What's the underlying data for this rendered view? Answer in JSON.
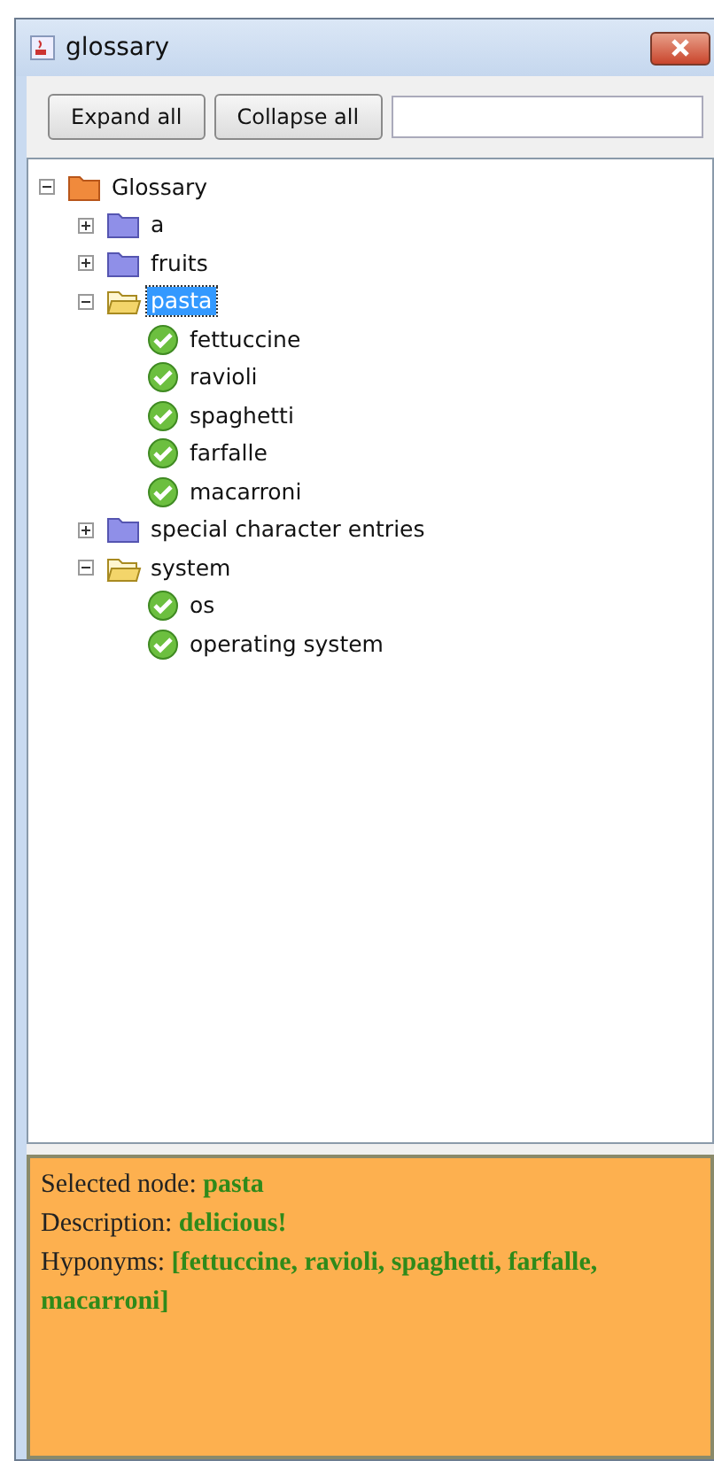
{
  "window": {
    "title": "glossary"
  },
  "toolbar": {
    "buttons": [
      "Expand all",
      "Collapse all"
    ]
  },
  "tree": [
    {
      "label": "Glossary",
      "kind": "root",
      "expanded": true,
      "selected": false,
      "children": [
        {
          "label": "a",
          "kind": "folder",
          "expanded": false,
          "selected": false
        },
        {
          "label": "fruits",
          "kind": "folder",
          "expanded": false,
          "selected": false
        },
        {
          "label": "pasta",
          "kind": "folder",
          "expanded": true,
          "selected": true,
          "children": [
            {
              "label": "fettuccine",
              "kind": "leaf",
              "selected": false
            },
            {
              "label": "ravioli",
              "kind": "leaf",
              "selected": false
            },
            {
              "label": "spaghetti",
              "kind": "leaf",
              "selected": false
            },
            {
              "label": "farfalle",
              "kind": "leaf",
              "selected": false
            },
            {
              "label": "macarroni",
              "kind": "leaf",
              "selected": false
            }
          ]
        },
        {
          "label": "special character entries",
          "kind": "folder",
          "expanded": false,
          "selected": false
        },
        {
          "label": "system",
          "kind": "folder",
          "expanded": true,
          "selected": false,
          "children": [
            {
              "label": "os",
              "kind": "leaf",
              "selected": false
            },
            {
              "label": "operating system",
              "kind": "leaf",
              "selected": false
            }
          ]
        }
      ]
    }
  ],
  "info": [
    "Selected node: **pasta**",
    "Description: **delicious!**",
    "Hyponyms: **[fettuccine, ravioli, spaghetti, farfalle, macarroni]**"
  ]
}
